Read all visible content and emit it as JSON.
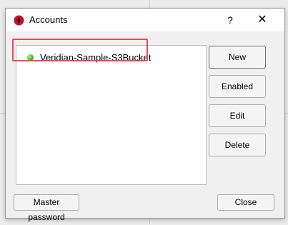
{
  "window": {
    "title": "Accounts",
    "help_label": "?",
    "close_glyph": "✕"
  },
  "accounts": [
    {
      "name": "Veridian-Sample-S3Bucket",
      "status": "online",
      "status_color": "#4cb52a",
      "highlighted": true
    }
  ],
  "buttons": {
    "new": "New",
    "enabled": "Enabled",
    "edit": "Edit",
    "delete": "Delete",
    "master_password": "Master password",
    "close": "Close"
  },
  "colors": {
    "highlight": "#e84a5a",
    "app_icon": "#c8102e"
  }
}
